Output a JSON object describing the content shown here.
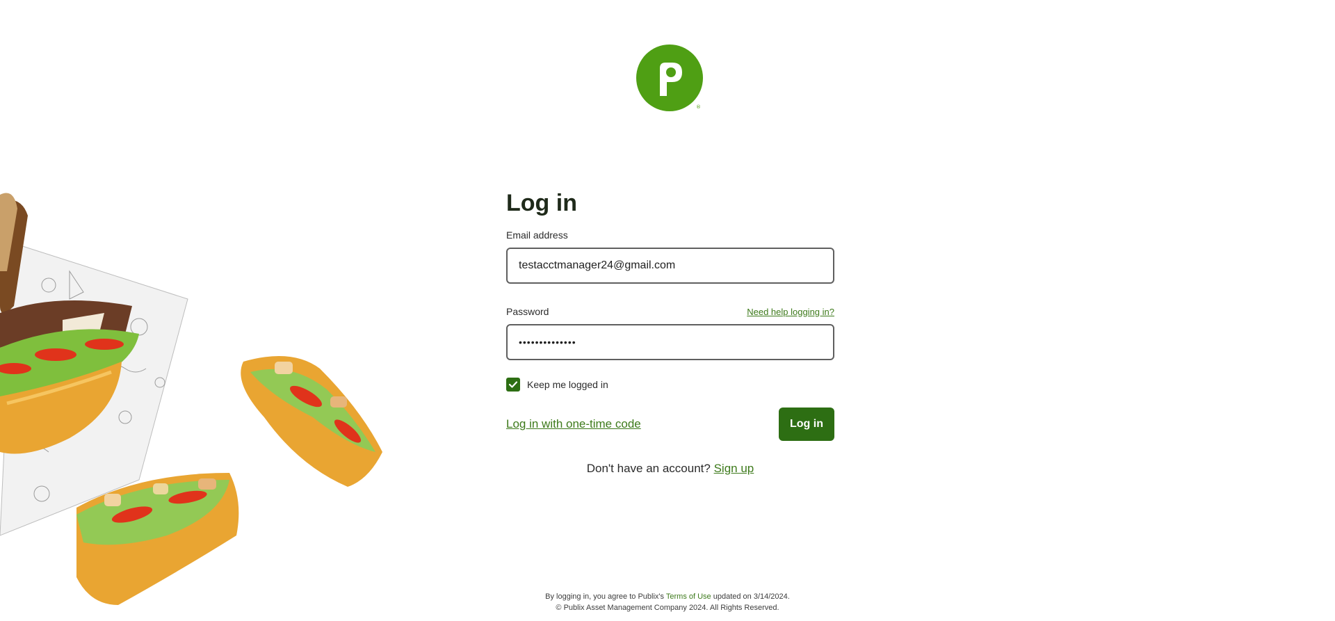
{
  "brand": {
    "logo_letter": "p",
    "color": "#4f9f14"
  },
  "form": {
    "title": "Log in",
    "email_label": "Email address",
    "email_value": "testacctmanager24@gmail.com",
    "password_label": "Password",
    "password_value": "••••••••••••••",
    "help_link": "Need help logging in?",
    "keep_logged_in_label": "Keep me logged in",
    "keep_logged_in_checked": true,
    "otp_link": "Log in with one-time code",
    "login_button": "Log in",
    "signup_prompt": "Don't have an account?",
    "signup_link": "Sign up"
  },
  "footer": {
    "line1_pre": "By logging in, you agree to Publix's",
    "terms_link": "Terms of Use",
    "line1_post": "updated on 3/14/2024.",
    "line2": "© Publix Asset Management Company 2024. All Rights Reserved."
  },
  "colors": {
    "accent": "#2d6e13",
    "link": "#3d7a1b"
  },
  "icons": {
    "checkbox": "check-icon",
    "logo": "publix-logo-icon"
  }
}
